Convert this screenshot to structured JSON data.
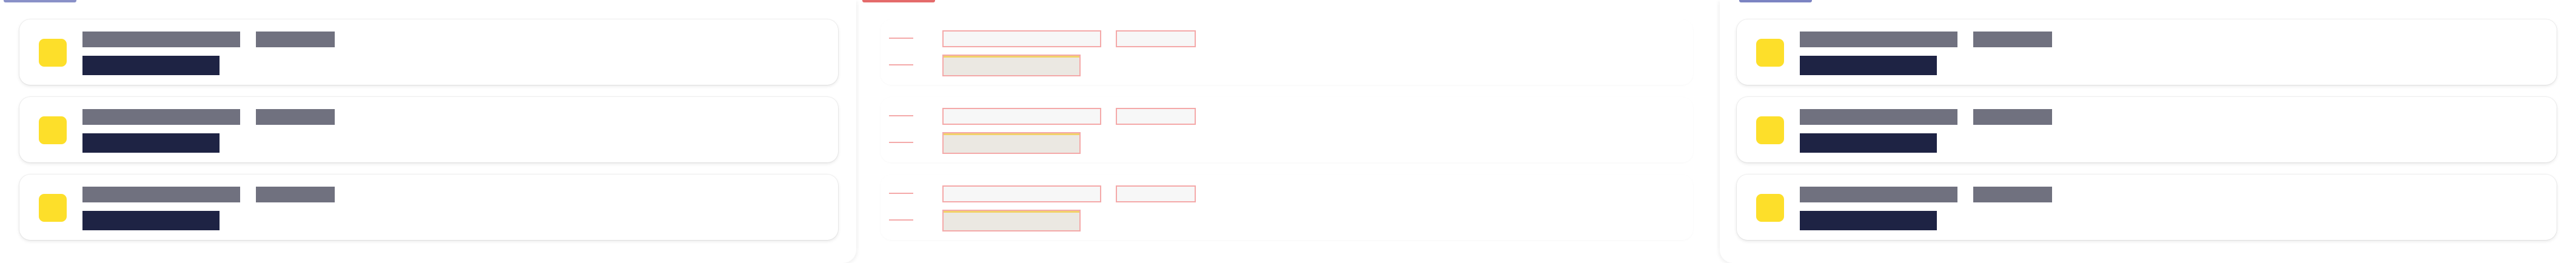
{
  "colors": {
    "accent_left": "#8a91c8",
    "accent_mid": "#e46b6b",
    "accent_right": "#7c84c2",
    "tile": "#fddf2a",
    "bar_title": "#70717f",
    "bar_value": "#1e2344"
  },
  "panels": [
    {
      "name": "left",
      "state": "loaded",
      "cards": [
        {
          "icon": "tile-icon"
        },
        {
          "icon": "tile-icon"
        },
        {
          "icon": "tile-icon"
        }
      ]
    },
    {
      "name": "middle",
      "state": "loading",
      "cards": [
        {
          "icon": "placeholder"
        },
        {
          "icon": "placeholder"
        },
        {
          "icon": "placeholder"
        }
      ]
    },
    {
      "name": "right",
      "state": "loaded",
      "cards": [
        {
          "icon": "tile-icon"
        },
        {
          "icon": "tile-icon"
        },
        {
          "icon": "tile-icon"
        }
      ]
    }
  ]
}
